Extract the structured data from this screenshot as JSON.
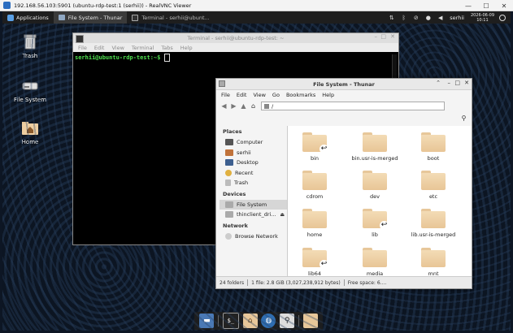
{
  "vnc": {
    "title": "192.168.56.103:5901 (ubuntu-rdp-test:1 (serhii)) - RealVNC Viewer",
    "minimize": "—",
    "maximize": "☐",
    "close": "✕"
  },
  "top_panel": {
    "applications": "Applications",
    "tasks": [
      {
        "label": "File System - Thunar"
      },
      {
        "label": "Terminal - serhii@ubunt..."
      }
    ],
    "user": "serhii",
    "date": "2026-06-09",
    "time": "10:11"
  },
  "desktop_icons": [
    {
      "label": "Trash"
    },
    {
      "label": "File System"
    },
    {
      "label": "Home"
    }
  ],
  "terminal": {
    "title": "Terminal - serhii@ubuntu-rdp-test: ~",
    "menu": [
      "File",
      "Edit",
      "View",
      "Terminal",
      "Tabs",
      "Help"
    ],
    "prompt": "serhii@ubuntu-rdp-test:~$"
  },
  "thunar": {
    "title": "File System - Thunar",
    "menu": [
      "File",
      "Edit",
      "View",
      "Go",
      "Bookmarks",
      "Help"
    ],
    "path": "/",
    "sidebar": {
      "places_header": "Places",
      "places": [
        "Computer",
        "serhii",
        "Desktop",
        "Recent",
        "Trash"
      ],
      "devices_header": "Devices",
      "devices": [
        "File System",
        "thinclient_dri..."
      ],
      "network_header": "Network",
      "network": [
        "Browse Network"
      ]
    },
    "files": [
      {
        "name": "bin",
        "link": true
      },
      {
        "name": "bin.usr-is-merged",
        "link": false
      },
      {
        "name": "boot",
        "link": false
      },
      {
        "name": "cdrom",
        "link": false
      },
      {
        "name": "dev",
        "link": false
      },
      {
        "name": "etc",
        "link": false
      },
      {
        "name": "home",
        "link": false
      },
      {
        "name": "lib",
        "link": true
      },
      {
        "name": "lib.usr-is-merged",
        "link": false
      },
      {
        "name": "lib64",
        "link": true
      },
      {
        "name": "media",
        "link": false
      },
      {
        "name": "mnt",
        "link": false
      }
    ],
    "status": {
      "folders": "24 folders",
      "file_info": "1 file: 2.8 GiB (3,027,238,912 bytes)",
      "free": "Free space: 6...."
    }
  },
  "icons": {
    "trash": "trash-icon",
    "drive": "drive-icon",
    "home": "home-icon"
  }
}
